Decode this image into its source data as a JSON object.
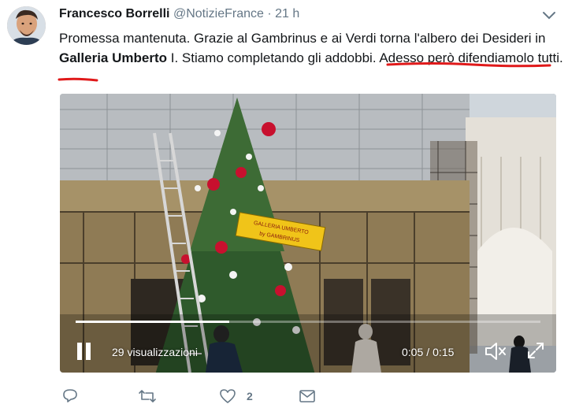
{
  "tweet": {
    "author_name": "Francesco Borrelli",
    "handle": "@NotizieFrance",
    "separator": "·",
    "time": "21 h",
    "text_part1": "Promessa mantenuta. Grazie al Gambrinus e ai Verdi torna l'albero dei Desideri in ",
    "text_bold": "Galleria Umberto",
    "text_part2": " I. Stiamo completando gli addobbi. Adesso però difendiamolo tutti."
  },
  "media": {
    "sign_text_line1": "GALLERIA UMBERTO",
    "sign_text_line2": "by GAMBRINUS",
    "views_label": "29 visualizzazioni",
    "current_time": "0:05",
    "time_separator": "/",
    "duration": "0:15",
    "progress_fraction": 0.33
  },
  "actions": {
    "reply_icon": "reply-icon",
    "retweet_icon": "retweet-icon",
    "like_icon": "heart-icon",
    "like_count": "2",
    "dm_icon": "envelope-icon"
  },
  "colors": {
    "underline": "#e0191a",
    "secondary_text": "#657786",
    "progress": "#ffffff"
  }
}
